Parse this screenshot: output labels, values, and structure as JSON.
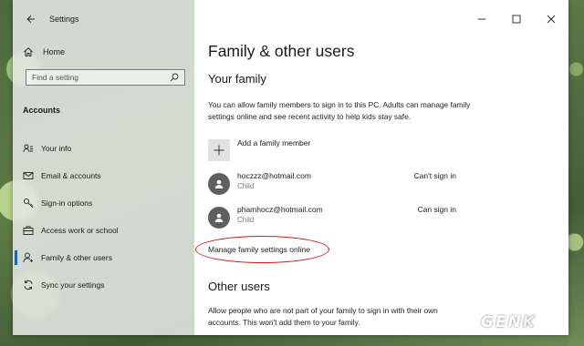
{
  "window": {
    "title": "Settings",
    "controls": {
      "minimize": "—",
      "maximize": "☐",
      "close": "✕"
    }
  },
  "sidebar": {
    "home_label": "Home",
    "search_placeholder": "Find a setting",
    "section_title": "Accounts",
    "items": [
      {
        "label": "Your info",
        "icon": "person-card-icon",
        "active": false
      },
      {
        "label": "Email & accounts",
        "icon": "mail-icon",
        "active": false
      },
      {
        "label": "Sign-in options",
        "icon": "key-icon",
        "active": false
      },
      {
        "label": "Access work or school",
        "icon": "briefcase-icon",
        "active": false
      },
      {
        "label": "Family & other users",
        "icon": "person-icon",
        "active": true
      },
      {
        "label": "Sync your settings",
        "icon": "sync-icon",
        "active": false
      }
    ]
  },
  "main": {
    "page_title": "Family & other users",
    "your_family": {
      "heading": "Your family",
      "description": "You can allow family members to sign in to this PC. Adults can manage family settings online and see recent activity to help kids stay safe.",
      "add_label": "Add a family member",
      "members": [
        {
          "email": "hoczzz@hotmail.com",
          "role": "Child",
          "status": "Can't sign in"
        },
        {
          "email": "phamhocz@hotmail.com",
          "role": "Child",
          "status": "Can sign in"
        }
      ],
      "manage_link": "Manage family settings online"
    },
    "other_users": {
      "heading": "Other users",
      "description": "Allow people who are not part of your family to sign in with their own accounts. This won't add them to your family."
    }
  },
  "watermark": {
    "text_left": "GEN",
    "text_right": "K"
  },
  "colors": {
    "accent": "#1e64b4",
    "highlight": "#d11a1a"
  }
}
